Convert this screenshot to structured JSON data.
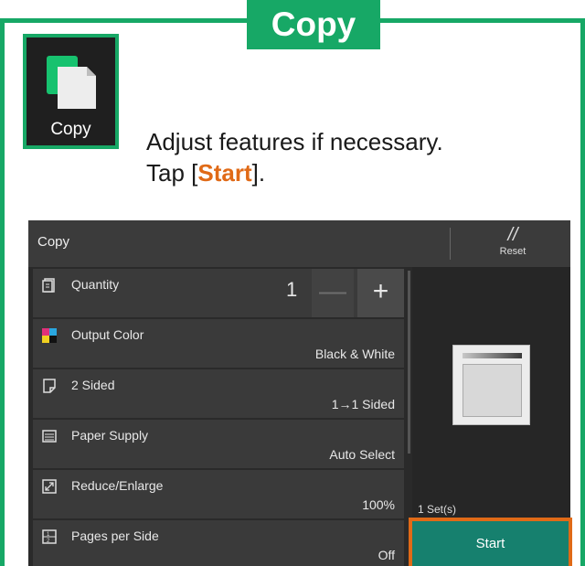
{
  "badge": {
    "title": "Copy"
  },
  "app_icon": {
    "label": "Copy",
    "icon": "copy-document-icon"
  },
  "instruction": {
    "line1": "Adjust features if necessary.",
    "line2_prefix": "Tap [",
    "line2_emphasis": "Start",
    "line2_suffix": "]."
  },
  "screen": {
    "header": {
      "title": "Copy",
      "reset_label": "Reset",
      "reset_glyph": "//"
    },
    "items": [
      {
        "label": "Quantity",
        "value": "1",
        "icon": "quantity-icon"
      },
      {
        "label": "Output Color",
        "value": "Black & White",
        "icon": "output-color-icon"
      },
      {
        "label": "2 Sided",
        "value": "1→1 Sided",
        "icon": "two-sided-icon"
      },
      {
        "label": "Paper Supply",
        "value": "Auto Select",
        "icon": "paper-supply-icon"
      },
      {
        "label": "Reduce/Enlarge",
        "value": "100%",
        "icon": "reduce-enlarge-icon"
      },
      {
        "label": "Pages per Side",
        "value": "Off",
        "icon": "pages-per-side-icon"
      }
    ],
    "quantity_controls": {
      "minus": "—",
      "plus": "+"
    },
    "sets_label": "1 Set(s)",
    "start_label": "Start"
  },
  "colors": {
    "brand_green": "#17a866",
    "highlight_orange": "#e06a17",
    "start_teal": "#16806e"
  }
}
